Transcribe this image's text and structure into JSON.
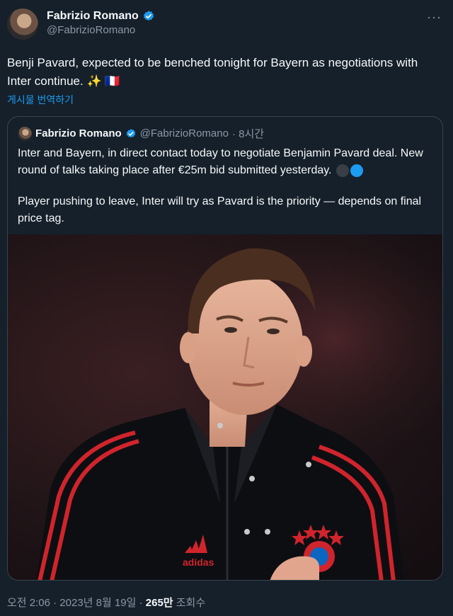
{
  "tweet": {
    "author_name": "Fabrizio Romano",
    "author_handle": "@FabrizioRomano",
    "more_label": "···",
    "text": "Benji Pavard, expected to be benched tonight for Bayern as negotiations with Inter continue. ✨ 🇫🇷",
    "translate_label": "게시물 번역하기",
    "icons": [
      "avatar",
      "verified-badge-icon",
      "more-icon"
    ]
  },
  "quoted_tweet": {
    "author_name": "Fabrizio Romano",
    "author_handle": "@FabrizioRomano",
    "time": "· 8시간",
    "paragraph_1": "Inter and Bayern, in direct contact today to negotiate Benjamin Pavard deal. New round of talks taking place after €25m bid submitted yesterday.",
    "paragraph_2": "Player pushing to leave, Inter will try as Pavard is the priority — depends on final price tag.",
    "emoji_colors": [
      "#3a3f45",
      "#1d9bf0"
    ],
    "photo_text": {
      "brand": "adidas"
    }
  },
  "meta": {
    "timestamp": "오전 2:06 · 2023년 8월 19일 · ",
    "views_count": "265만",
    "views_label": " 조회수"
  },
  "colors": {
    "background": "#15202b",
    "accent": "#1d9bf0",
    "muted": "#8b98a5",
    "border": "#38444d",
    "jacket_stripe": "#d0242c"
  }
}
